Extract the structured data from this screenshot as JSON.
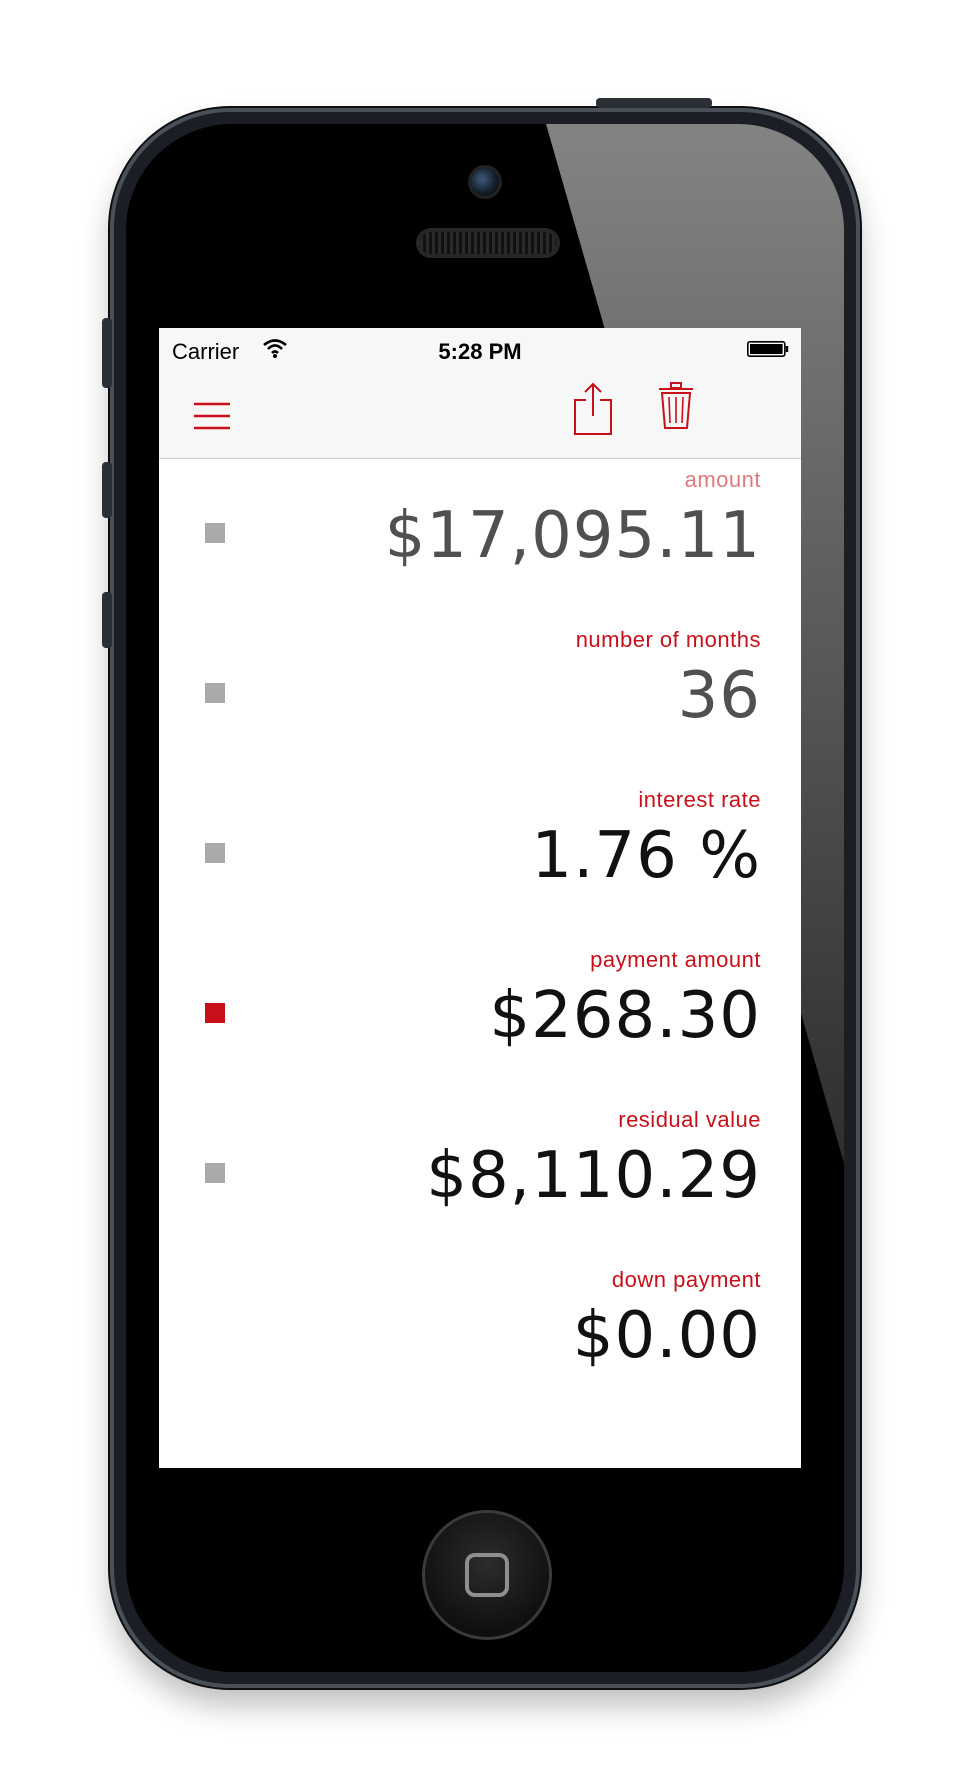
{
  "status_bar": {
    "carrier": "Carrier",
    "time": "5:28 PM"
  },
  "nav_bar": {
    "menu_icon": "hamburger-menu-icon",
    "share_icon": "share-icon",
    "delete_icon": "trash-icon"
  },
  "colors": {
    "accent": "#c8101b",
    "marker_inactive": "#aaaaaa"
  },
  "fields": [
    {
      "label": "amount",
      "value": "$17,095.11",
      "selected": false
    },
    {
      "label": "number of months",
      "value": "36",
      "selected": false
    },
    {
      "label": "interest rate",
      "value": "1.76 %",
      "selected": false
    },
    {
      "label": "payment amount",
      "value": "$268.30",
      "selected": true
    },
    {
      "label": "residual value",
      "value": "$8,110.29",
      "selected": false
    },
    {
      "label": "down payment",
      "value": "$0.00",
      "selected": false
    }
  ]
}
